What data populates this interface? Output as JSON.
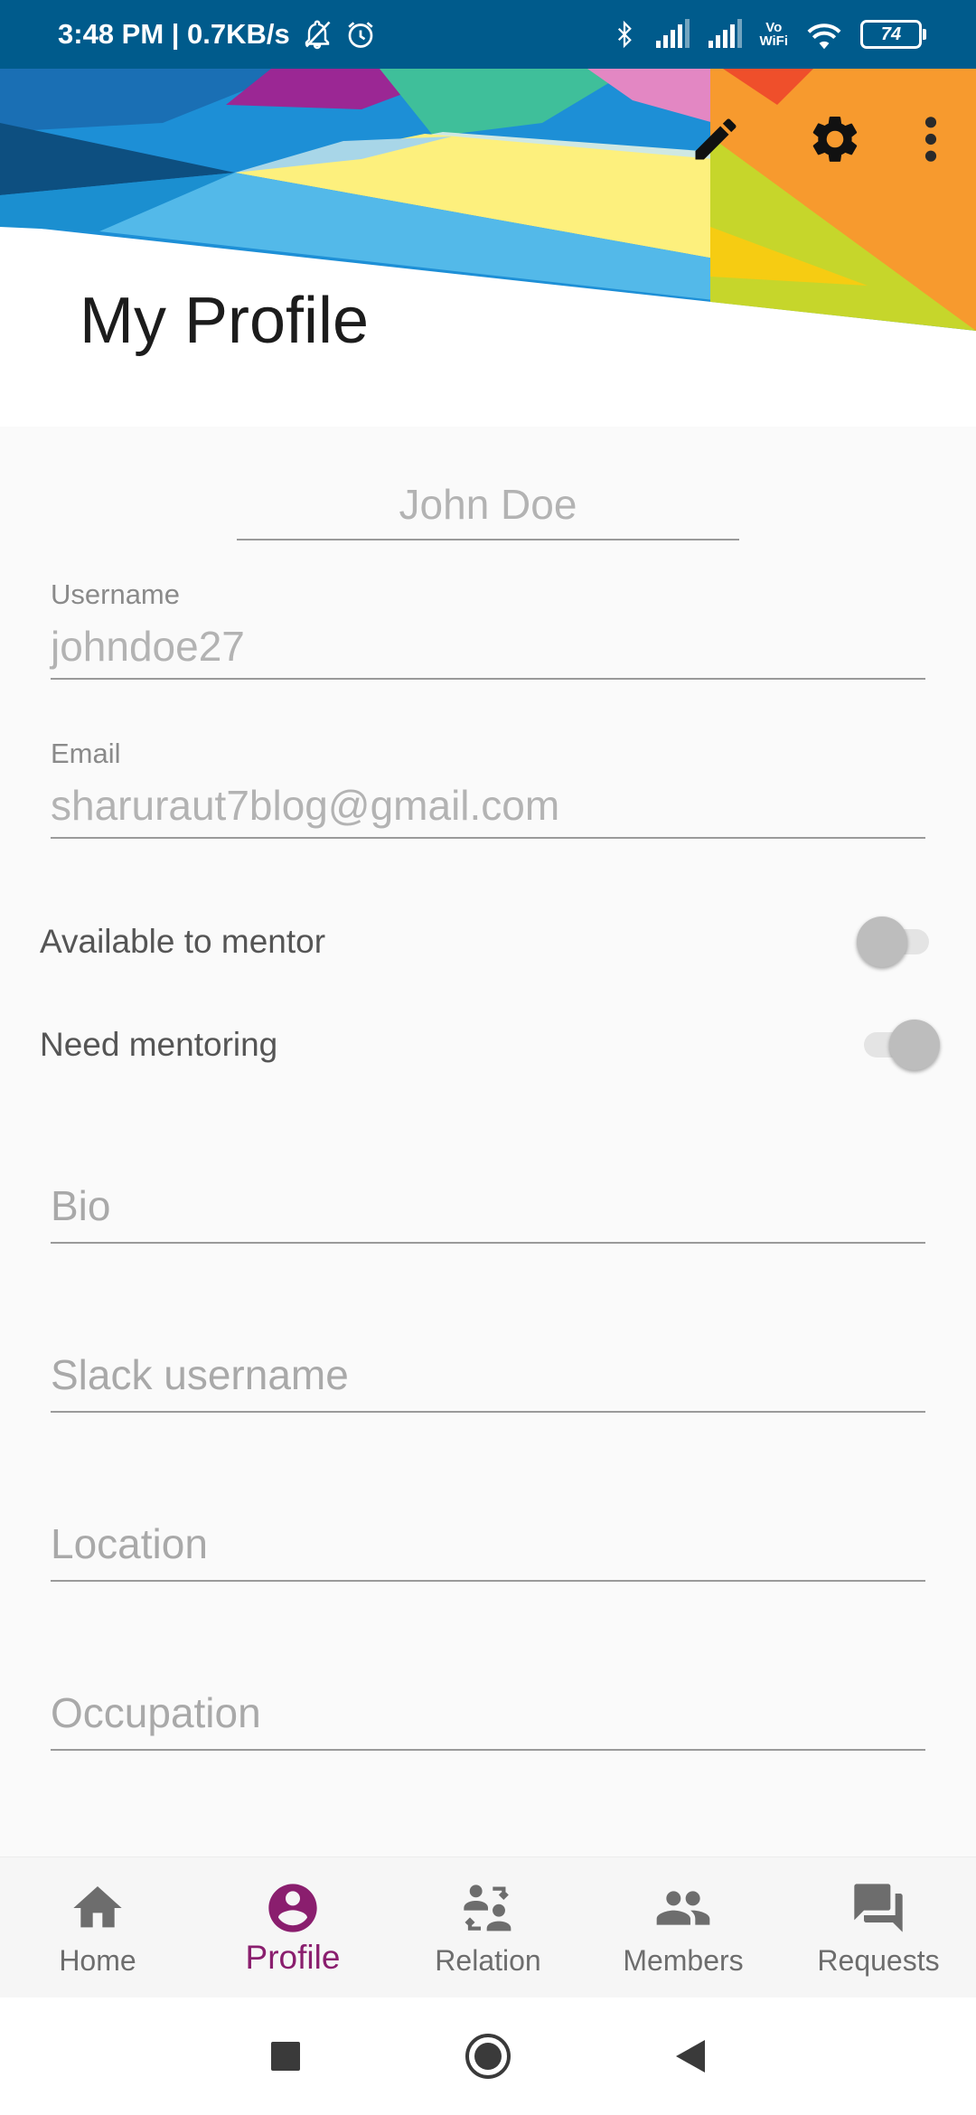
{
  "status_bar": {
    "time_speed": "3:48 PM | 0.7KB/s",
    "vowifi_top": "Vo",
    "vowifi_bottom": "WiFi",
    "battery": "74"
  },
  "header": {
    "title": "My Profile",
    "icons": [
      "pencil-icon",
      "gear-icon",
      "more-vert-icon"
    ]
  },
  "profile": {
    "name": "John Doe",
    "username_label": "Username",
    "username_value": "johndoe27",
    "email_label": "Email",
    "email_value": "sharuraut7blog@gmail.com",
    "available_to_mentor_label": "Available to mentor",
    "available_to_mentor": false,
    "need_mentoring_label": "Need mentoring",
    "need_mentoring": true,
    "bio_placeholder": "Bio",
    "slack_placeholder": "Slack username",
    "location_placeholder": "Location",
    "occupation_placeholder": "Occupation"
  },
  "bottom_nav": {
    "items": [
      {
        "label": "Home",
        "icon": "home-icon",
        "active": false
      },
      {
        "label": "Profile",
        "icon": "account-circle-icon",
        "active": true
      },
      {
        "label": "Relation",
        "icon": "relation-icon",
        "active": false
      },
      {
        "label": "Members",
        "icon": "group-icon",
        "active": false
      },
      {
        "label": "Requests",
        "icon": "forum-icon",
        "active": false
      }
    ]
  },
  "colors": {
    "status_bar": "#005b8c",
    "accent": "#8a1e6e",
    "inactive_icon": "#6d6d6d"
  }
}
